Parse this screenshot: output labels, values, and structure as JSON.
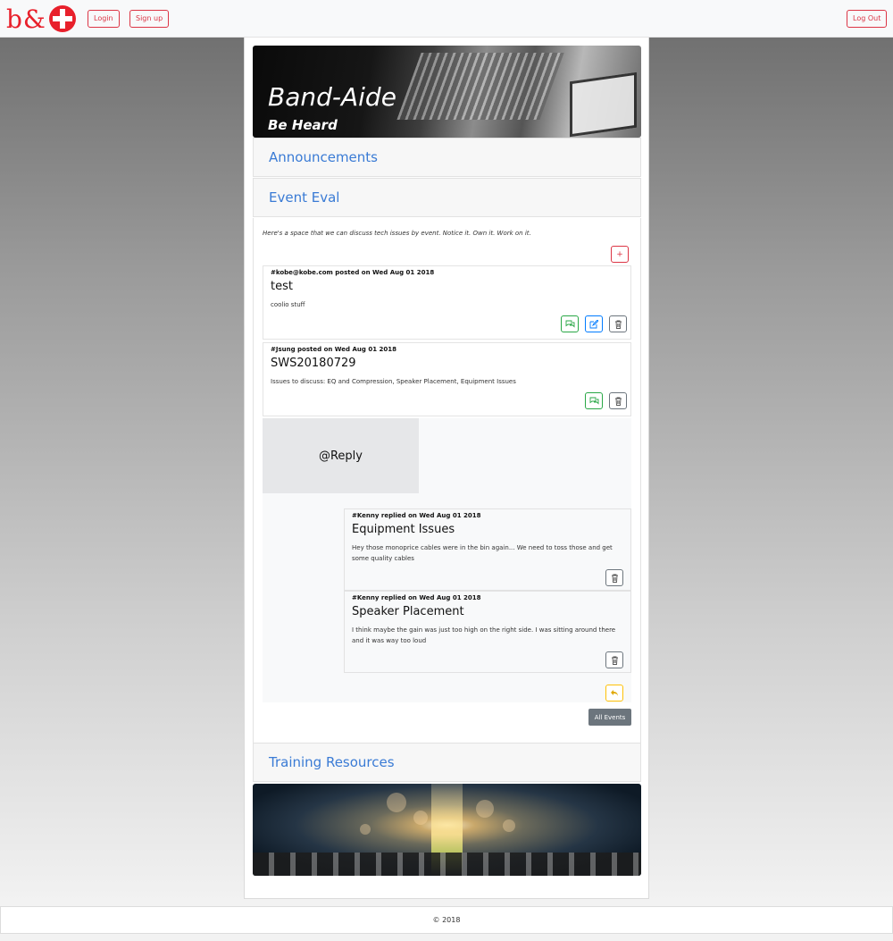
{
  "navbar": {
    "logo_text": "b&",
    "login_label": "Login",
    "signup_label": "Sign up",
    "logout_label": "Log Out"
  },
  "hero": {
    "title": "Band-Aide",
    "subtitle": "Be Heard"
  },
  "sections": {
    "announcements": "Announcements",
    "event_eval": "Event Eval",
    "training_resources": "Training Resources"
  },
  "event_eval": {
    "intro": "Here's a space that we can discuss tech issues by event. Notice it. Own it. Work on it.",
    "add_label": "+",
    "posts": [
      {
        "meta": "#kobe@kobe.com posted on Wed Aug 01 2018",
        "title": "test",
        "body": "coolio stuff"
      },
      {
        "meta": "#Jsung posted on Wed Aug 01 2018",
        "title": "SWS20180729",
        "body": "Issues to discuss: EQ and Compression, Speaker Placement, Equipment Issues"
      }
    ],
    "reply_tag": "@Reply",
    "replies": [
      {
        "meta": "#Kenny replied on Wed Aug 01 2018",
        "title": "Equipment Issues",
        "body": "Hey those monoprice cables were in the bin again... We need to toss those and get some quality cables"
      },
      {
        "meta": "#Kenny replied on Wed Aug 01 2018",
        "title": "Speaker Placement",
        "body": "I think maybe the gain was just too high on the right side. I was sitting around there and it was way too loud"
      }
    ],
    "all_events_label": "All Events"
  },
  "footer": {
    "copyright": "© 2018"
  },
  "colors": {
    "brand_red": "#e8202b",
    "link_blue": "#3a7bd5",
    "danger": "#dc3545",
    "success": "#28a745",
    "primary": "#007bff",
    "secondary": "#6c757d",
    "warning": "#ffc107"
  },
  "icons": [
    "plus-icon",
    "comments-icon",
    "edit-icon",
    "trash-icon",
    "reply-icon"
  ]
}
